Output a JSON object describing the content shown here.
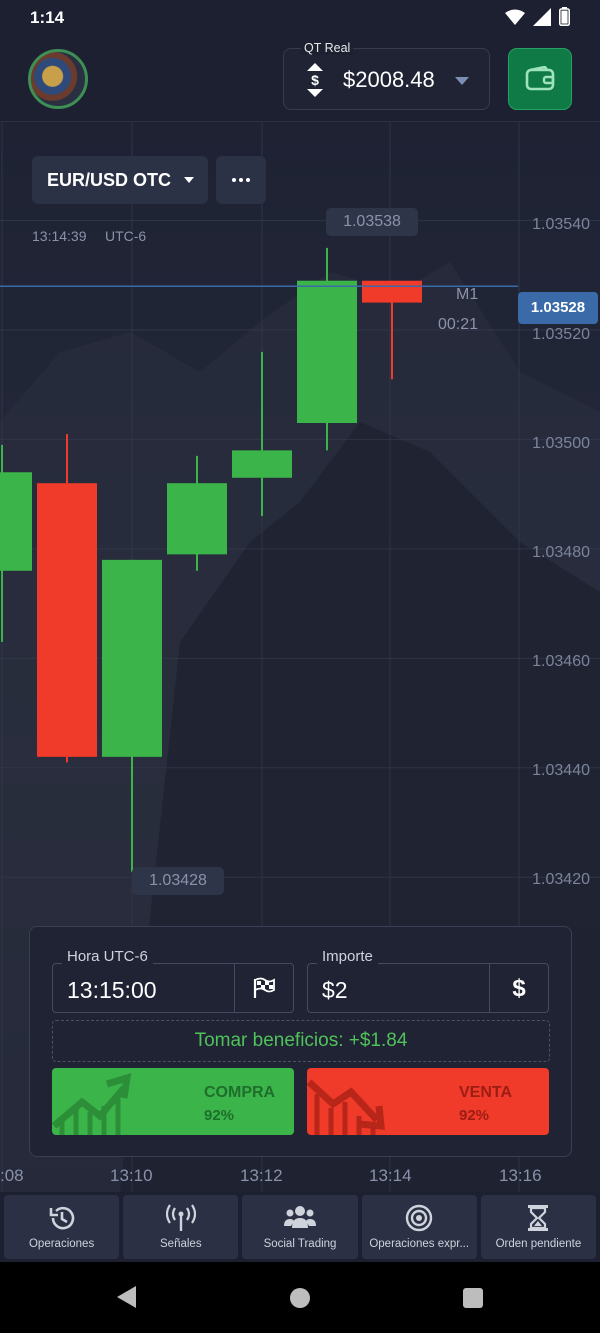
{
  "status_bar": {
    "time": "1:14"
  },
  "header": {
    "account_label": "QT Real",
    "balance": "$2008.48",
    "icons": [
      "dollar-switch-icon",
      "chevron-down-icon",
      "wallet-icon"
    ]
  },
  "chart": {
    "pair": "EUR/USD OTC",
    "server_time": "13:14:39",
    "timezone": "UTC-6",
    "timeframe": "M1",
    "countdown": "00:21",
    "current_price": "1.03528",
    "high_label": "1.03538",
    "low_label": "1.03428",
    "y_labels": [
      "1.03540",
      "1.03520",
      "1.03500",
      "1.03480",
      "1.03460",
      "1.03440",
      "1.03420"
    ],
    "x_labels": [
      ":08",
      "13:10",
      "13:12",
      "13:14",
      "13:16"
    ],
    "colors": {
      "up": "#3bb54a",
      "down": "#f03a2a",
      "price_line": "#3a6aa8"
    }
  },
  "chart_data": {
    "type": "candlestick",
    "ylim": [
      1.0341,
      1.03558
    ],
    "candles": [
      {
        "open": 1.03476,
        "close": 1.03494,
        "high": 1.03499,
        "low": 1.03463
      },
      {
        "open": 1.03492,
        "close": 1.03442,
        "high": 1.03501,
        "low": 1.03441
      },
      {
        "open": 1.03442,
        "close": 1.03478,
        "high": 1.03478,
        "low": 1.03421
      },
      {
        "open": 1.03479,
        "close": 1.03492,
        "high": 1.03497,
        "low": 1.03476
      },
      {
        "open": 1.03493,
        "close": 1.03498,
        "high": 1.03516,
        "low": 1.03486
      },
      {
        "open": 1.03503,
        "close": 1.03529,
        "high": 1.03535,
        "low": 1.03498
      },
      {
        "open": 1.03529,
        "close": 1.03525,
        "high": 1.03529,
        "low": 1.03511
      }
    ]
  },
  "trade": {
    "time_label": "Hora UTC-6",
    "time_value": "13:15:00",
    "amount_label": "Importe",
    "amount_value": "$2",
    "profit_text": "Tomar beneficios: +$1.84",
    "buy_label": "COMPRA",
    "buy_pct": "92%",
    "sell_label": "VENTA",
    "sell_pct": "92%"
  },
  "nav": [
    {
      "label": "Operaciones",
      "icon": "history-icon"
    },
    {
      "label": "Señales",
      "icon": "signal-antenna-icon"
    },
    {
      "label": "Social Trading",
      "icon": "people-icon"
    },
    {
      "label": "Operaciones expr...",
      "icon": "target-icon"
    },
    {
      "label": "Orden pendiente",
      "icon": "hourglass-icon"
    }
  ]
}
